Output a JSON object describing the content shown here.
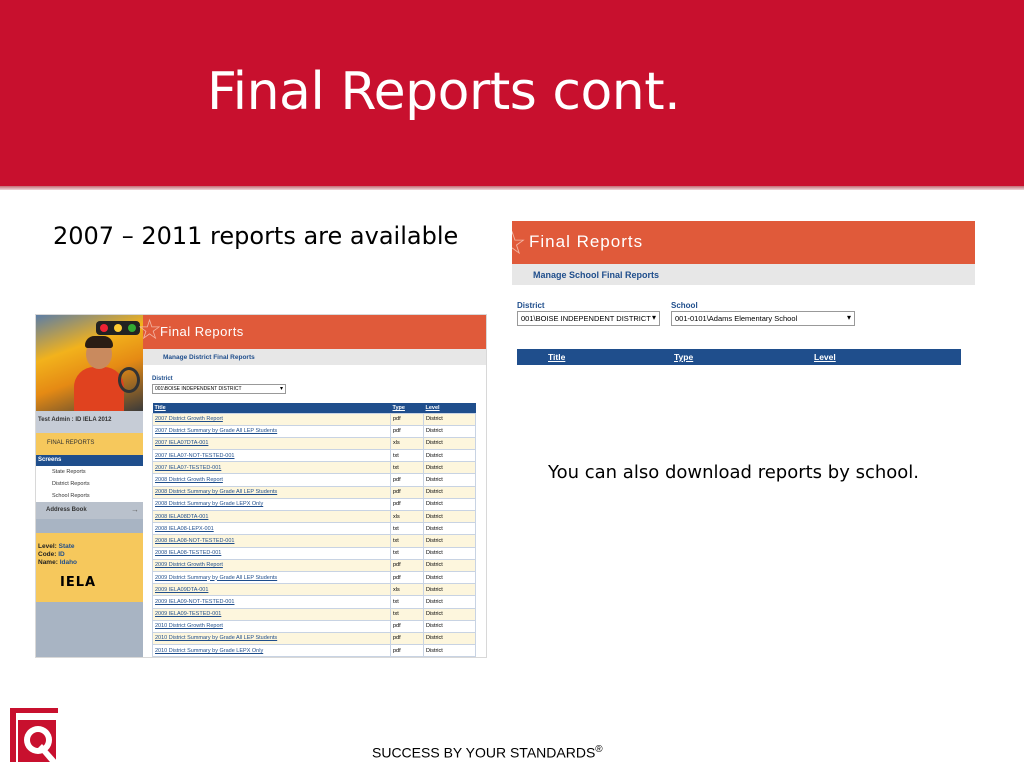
{
  "slide": {
    "title": "Final Reports cont.",
    "bullet": "2007 – 2011 reports are available",
    "note": "You can also download reports by school.",
    "footer": "SUCCESS BY YOUR STANDARDS",
    "footer_mark": "®",
    "colors": {
      "header": "#c8102e",
      "app_banner": "#e05a3a",
      "navy": "#1f4e8c",
      "gold": "#f6c85c"
    }
  },
  "left_screen": {
    "banner_title": "Final Reports",
    "subheading": "Manage District Final Reports",
    "sidebar": {
      "admin": "Test Admin : ID IELA 2012",
      "final_reports": "FINAL REPORTS",
      "screens": "Screens",
      "links": [
        "State Reports",
        "District Reports",
        "School Reports"
      ],
      "address_book": "Address Book",
      "level_label": "Level:",
      "level_value": "State",
      "code_label": "Code:",
      "code_value": "ID",
      "name_label": "Name:",
      "name_value": "Idaho",
      "logo_text": "IELA"
    },
    "district_label": "District",
    "district_value": "001\\BOISE INDEPENDENT DISTRICT",
    "table": {
      "headers": [
        "Title",
        "Type",
        "Level"
      ],
      "rows": [
        [
          "2007 District Growth Report",
          "pdf",
          "District"
        ],
        [
          "2007 District Summary by Grade All LEP Students",
          "pdf",
          "District"
        ],
        [
          "2007 IELA07DTA-001",
          "xls",
          "District"
        ],
        [
          "2007 IELA07-NOT-TESTED-001",
          "txt",
          "District"
        ],
        [
          "2007 IELA07-TESTED-001",
          "txt",
          "District"
        ],
        [
          "2008 District Growth Report",
          "pdf",
          "District"
        ],
        [
          "2008 District Summary by Grade All LEP Students",
          "pdf",
          "District"
        ],
        [
          "2008 District Summary by Grade LEPX Only",
          "pdf",
          "District"
        ],
        [
          "2008 IELA08DTA-001",
          "xls",
          "District"
        ],
        [
          "2008 IELA08-LEPX-001",
          "txt",
          "District"
        ],
        [
          "2008 IELA08-NOT-TESTED-001",
          "txt",
          "District"
        ],
        [
          "2008 IELA08-TESTED-001",
          "txt",
          "District"
        ],
        [
          "2009 District Growth Report",
          "pdf",
          "District"
        ],
        [
          "2009 District Summary by Grade All LEP Students",
          "pdf",
          "District"
        ],
        [
          "2009 IELA09DTA-001",
          "xls",
          "District"
        ],
        [
          "2009 IELA09-NOT-TESTED-001",
          "txt",
          "District"
        ],
        [
          "2009 IELA09-TESTED-001",
          "txt",
          "District"
        ],
        [
          "2010 District Growth Report",
          "pdf",
          "District"
        ],
        [
          "2010 District Summary by Grade All LEP Students",
          "pdf",
          "District"
        ],
        [
          "2010 District Summary by Grade LEPX Only",
          "pdf",
          "District"
        ]
      ]
    }
  },
  "right_screen": {
    "banner_title": "Final Reports",
    "subheading": "Manage School Final Reports",
    "district_label": "District",
    "district_value": "001\\BOISE INDEPENDENT DISTRICT",
    "school_label": "School",
    "school_value": "001-0101\\Adams Elementary School",
    "table_headers": [
      "Title",
      "Type",
      "Level"
    ]
  }
}
